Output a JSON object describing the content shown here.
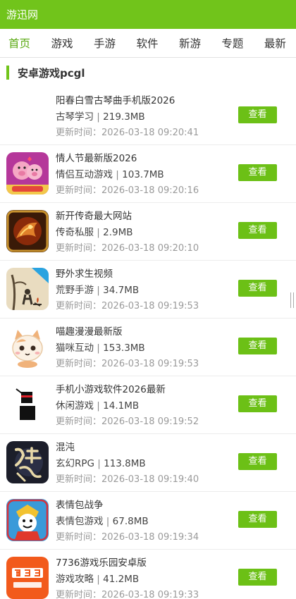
{
  "header": {
    "logo": "游迅网"
  },
  "nav": {
    "items": [
      {
        "label": "首页",
        "active": true
      },
      {
        "label": "游戏"
      },
      {
        "label": "手游"
      },
      {
        "label": "软件"
      },
      {
        "label": "新游"
      },
      {
        "label": "专题"
      },
      {
        "label": "最新"
      }
    ]
  },
  "section": {
    "title": "安卓游戏pcgl"
  },
  "time_prefix": "更新时间：",
  "view_label": "查看",
  "apps": [
    {
      "name": "阳春白雪古琴曲手机版2026",
      "category": "古琴学习",
      "size": "219.3MB",
      "updated": "2026-03-18 09:20:41",
      "icon": "blank-icon"
    },
    {
      "name": "情人节最新版2026",
      "category": "情侣互动游戏",
      "size": "103.7MB",
      "updated": "2026-03-18 09:20:16",
      "icon": "pig-couple-icon"
    },
    {
      "name": "新开传奇最大网站",
      "category": "传奇私服",
      "size": "2.9MB",
      "updated": "2026-03-18 09:20:10",
      "icon": "dragon-warrior-icon"
    },
    {
      "name": "野外求生视频",
      "category": "荒野手游",
      "size": "34.7MB",
      "updated": "2026-03-18 09:19:53",
      "icon": "campfire-survival-icon"
    },
    {
      "name": "喵趣漫漫最新版",
      "category": "猫咪互动",
      "size": "153.3MB",
      "updated": "2026-03-18 09:19:53",
      "icon": "cat-icon"
    },
    {
      "name": "手机小游戏软件2026最新",
      "category": "休闲游戏",
      "size": "14.1MB",
      "updated": "2026-03-18 09:19:52",
      "icon": "ninja-icon"
    },
    {
      "name": "混沌",
      "category": "玄幻RPG",
      "size": "113.8MB",
      "updated": "2026-03-18 09:19:40",
      "icon": "chaos-calligraphy-icon"
    },
    {
      "name": "表情包战争",
      "category": "表情包游戏",
      "size": "67.8MB",
      "updated": "2026-03-18 09:19:34",
      "icon": "meme-warrior-icon"
    },
    {
      "name": "7736游戏乐园安卓版",
      "category": "游戏攻略",
      "size": "41.2MB",
      "updated": "2026-03-18 09:19:33",
      "icon": "333-logo-icon"
    }
  ]
}
